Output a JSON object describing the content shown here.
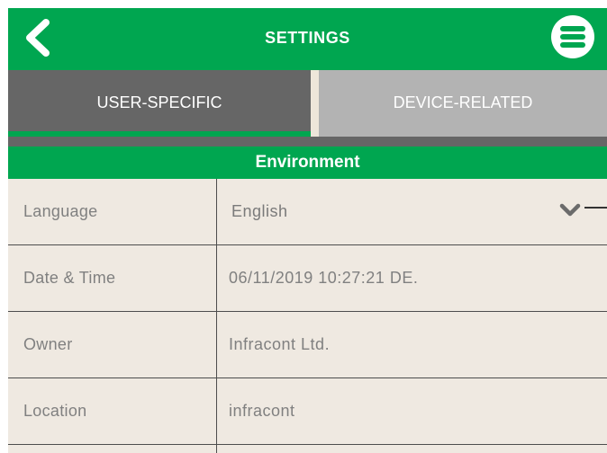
{
  "header": {
    "title": "SETTINGS",
    "back_icon": "chevron-left-icon",
    "menu_icon": "hamburger-menu-icon",
    "color": "#00a650"
  },
  "tabs": [
    {
      "label": "USER-SPECIFIC",
      "active": true
    },
    {
      "label": "DEVICE-RELATED",
      "active": false
    }
  ],
  "section": {
    "title": "Environment"
  },
  "settings": [
    {
      "label": "Language",
      "value": "English",
      "control": "dropdown"
    },
    {
      "label": "Date & Time",
      "value": "06/11/2019 10:27:21 DE."
    },
    {
      "label": "Owner",
      "value": "Infracont Ltd."
    },
    {
      "label": "Location",
      "value": "infracont"
    }
  ]
}
